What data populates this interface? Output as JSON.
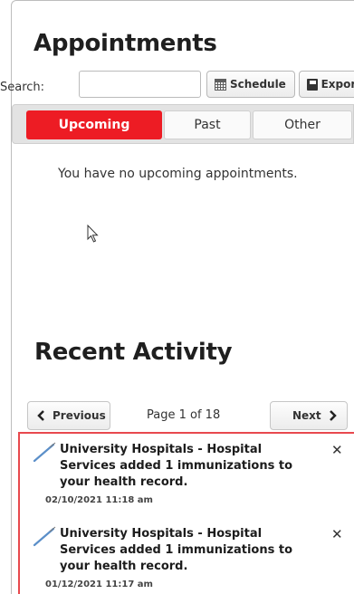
{
  "appointments": {
    "title": "Appointments",
    "search_label": "Search:",
    "search_value": "",
    "schedule_label": "Schedule",
    "export_label": "Export",
    "tabs": [
      {
        "label": "Upcoming",
        "active": true
      },
      {
        "label": "Past",
        "active": false
      },
      {
        "label": "Other",
        "active": false
      }
    ],
    "empty_message": "You have no upcoming appointments."
  },
  "recent_activity": {
    "title": "Recent Activity",
    "previous_label": "Previous",
    "next_label": "Next",
    "page_info": "Page 1 of 18",
    "items": [
      {
        "text": "University Hospitals - Hospital Services added 1 immunizations to your health record.",
        "timestamp": "02/10/2021 11:18 am",
        "icon": "syringe-icon"
      },
      {
        "text": "University Hospitals - Hospital Services added 1 immunizations to your health record.",
        "timestamp": "01/12/2021 11:17 am",
        "icon": "syringe-icon"
      }
    ]
  },
  "colors": {
    "accent": "#ed1c24",
    "highlight_border": "#e8494e"
  }
}
